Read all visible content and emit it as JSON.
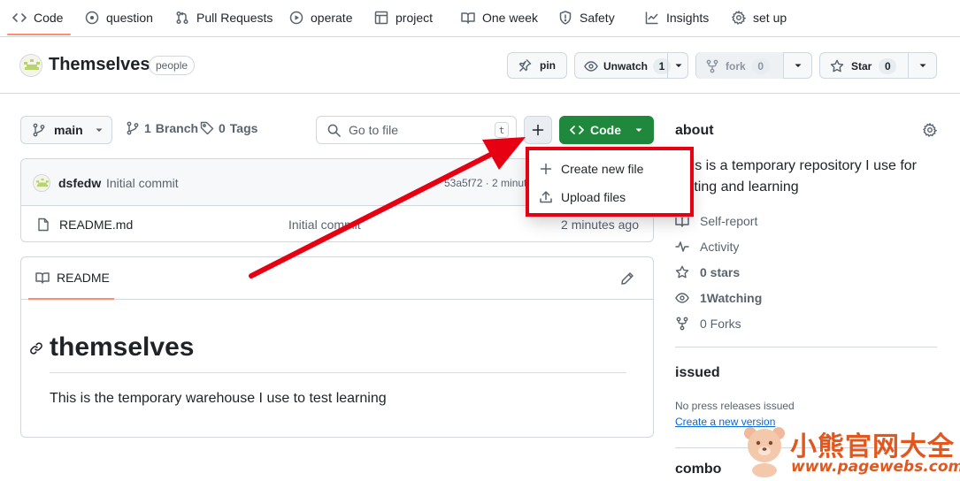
{
  "nav": {
    "tabs": [
      {
        "label": "Code",
        "icon": "code-icon",
        "active": true
      },
      {
        "label": "question",
        "icon": "issue-icon"
      },
      {
        "label": "Pull Requests",
        "icon": "pull-request-icon"
      },
      {
        "label": "operate",
        "icon": "play-icon"
      },
      {
        "label": "project",
        "icon": "table-icon"
      },
      {
        "label": "One week",
        "icon": "book-icon"
      },
      {
        "label": "Safety",
        "icon": "shield-icon"
      },
      {
        "label": "Insights",
        "icon": "graph-icon"
      },
      {
        "label": "set up",
        "icon": "gear-icon"
      }
    ],
    "active_color": "#fd8c73"
  },
  "repo": {
    "name": "Themselves",
    "visibility": "people",
    "pin_label": "pin",
    "unwatch_label": "Unwatch",
    "watch_count": "1",
    "fork_label": "fork",
    "fork_count": "0",
    "star_label": "Star",
    "star_count": "0"
  },
  "toolbar": {
    "branch": "main",
    "branch_count": "1",
    "branch_word": "Branch",
    "tags_count": "0",
    "tags_word": "Tags",
    "goto_placeholder": "Go to file",
    "goto_key": "t",
    "plus_label": "+",
    "code_label": "Code",
    "code_color": "#1f883d"
  },
  "latest_commit": {
    "author": "dsfedw",
    "message": "Initial commit",
    "sha_age": "53a5f72 · 2 minutes ago"
  },
  "files": [
    {
      "name": "README.md",
      "commit": "Initial commit",
      "age": "2 minutes ago"
    }
  ],
  "readme": {
    "tab_label": "README",
    "heading": "themselves",
    "body": "This is the temporary warehouse I use to test learning"
  },
  "dropdown": {
    "items": [
      {
        "label": "Create new file",
        "icon": "plus-icon"
      },
      {
        "label": "Upload files",
        "icon": "upload-icon"
      }
    ],
    "highlight_color": "#e60012"
  },
  "sidebar": {
    "about_title": "about",
    "description": "This is a temporary repository I use for testing and learning",
    "items": [
      {
        "label": "Self-report",
        "icon": "book-icon"
      },
      {
        "label": "Activity",
        "icon": "pulse-icon"
      },
      {
        "label": "0 stars",
        "icon": "star-icon"
      },
      {
        "label": "1Watching",
        "icon": "eye-icon"
      },
      {
        "label": "0 Forks",
        "icon": "fork-icon"
      }
    ],
    "releases_title": "issued",
    "releases_empty": "No press releases issued",
    "releases_link": "Create a new version",
    "packages_title": "combo"
  },
  "watermark": {
    "cn": "小熊官网大全",
    "url": "www.pagewebs.com"
  }
}
